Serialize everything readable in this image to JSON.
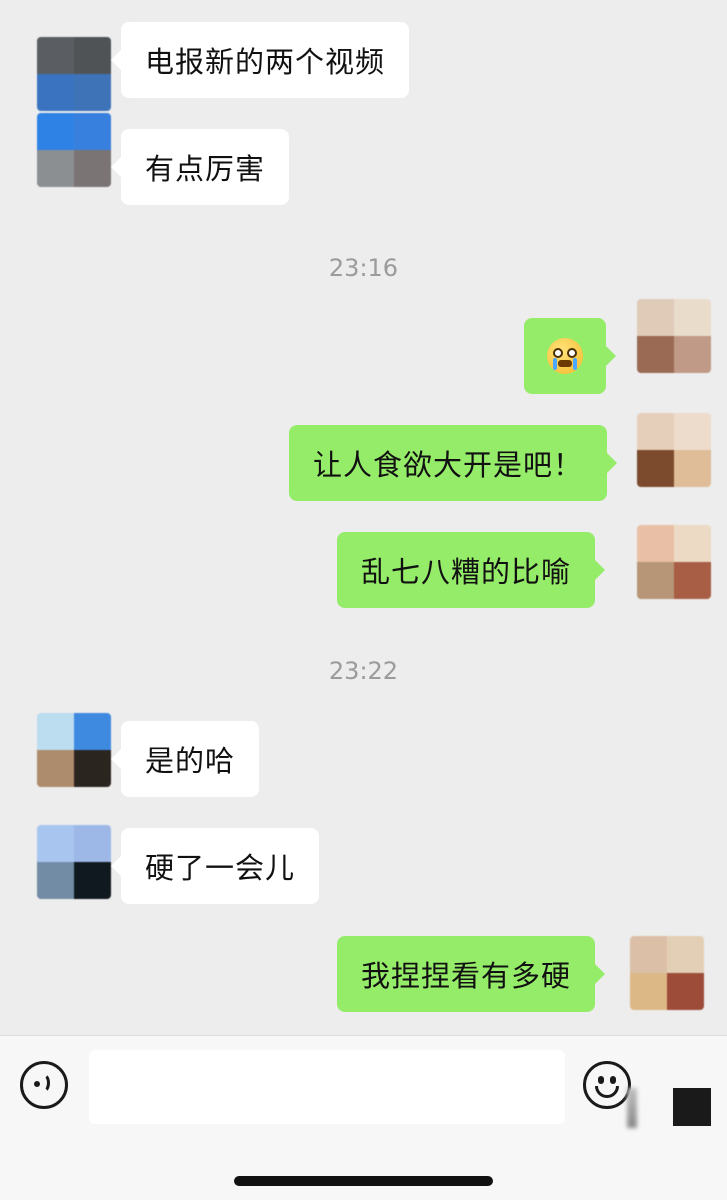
{
  "colors": {
    "background": "#ededed",
    "bubble_incoming": "#ffffff",
    "bubble_outgoing": "#95ec69",
    "timestamp": "#9b9b9b"
  },
  "messages": [
    {
      "side": "left",
      "text": "电报新的两个视频"
    },
    {
      "side": "left",
      "text": "有点厉害"
    },
    {
      "type": "time",
      "text": "23:16"
    },
    {
      "side": "right",
      "icon": "crying-face-emoji-icon"
    },
    {
      "side": "right",
      "text": "让人食欲大开是吧！"
    },
    {
      "side": "right",
      "text": "乱七八糟的比喻"
    },
    {
      "type": "time",
      "text": "23:22"
    },
    {
      "side": "left",
      "text": "是的哈"
    },
    {
      "side": "left",
      "text": "硬了一会儿"
    },
    {
      "side": "right",
      "text": "我捏捏看有多硬"
    }
  ],
  "input_bar": {
    "voice_icon": "voice-icon",
    "emoji_icon": "emoji-icon",
    "more_icon": "more-icon",
    "text_value": ""
  }
}
